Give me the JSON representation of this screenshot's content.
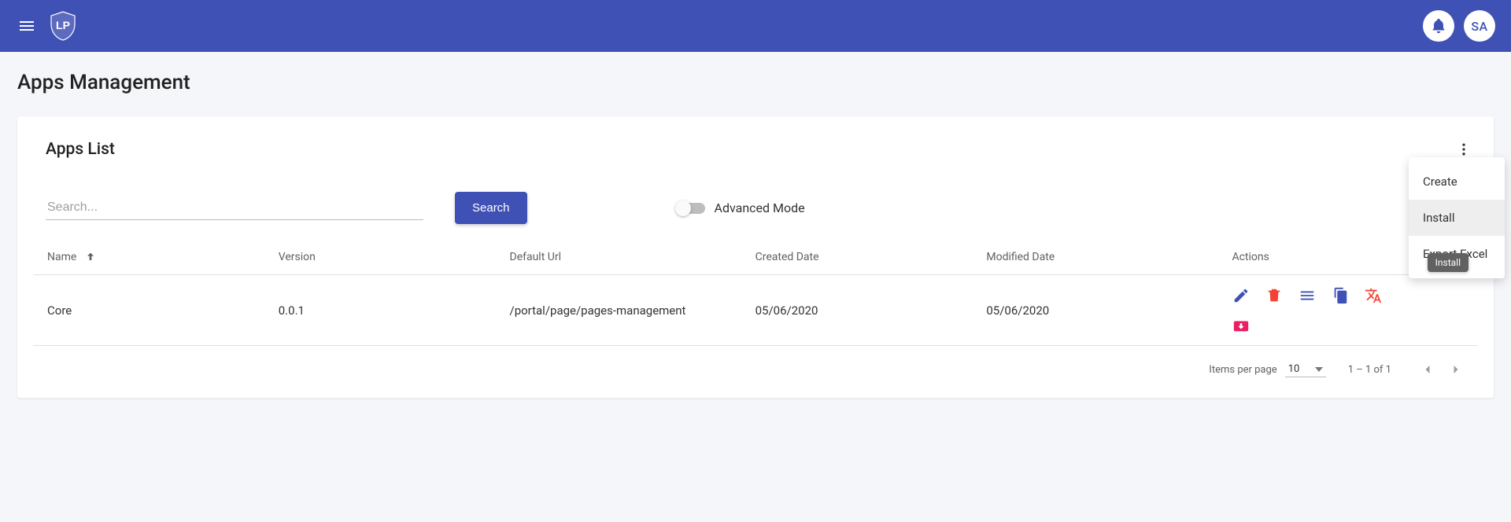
{
  "appbar": {
    "user_initials": "SA"
  },
  "page": {
    "title": "Apps Management"
  },
  "card": {
    "title": "Apps List"
  },
  "filter": {
    "search_placeholder": "Search...",
    "search_button": "Search",
    "advanced_mode_label": "Advanced Mode",
    "advanced_mode_on": false
  },
  "table": {
    "columns": {
      "name": "Name",
      "version": "Version",
      "default_url": "Default Url",
      "created_date": "Created Date",
      "modified_date": "Modified Date",
      "actions": "Actions"
    },
    "sort_column": "name",
    "sort_direction": "asc",
    "rows": [
      {
        "name": "Core",
        "version": "0.0.1",
        "default_url": "/portal/page/pages-management",
        "created_date": "05/06/2020",
        "modified_date": "05/06/2020"
      }
    ]
  },
  "paginator": {
    "items_per_page_label": "Items per page",
    "page_size": "10",
    "range_label": "1 – 1 of 1"
  },
  "menu": {
    "items": [
      {
        "label": "Create",
        "highlighted": false
      },
      {
        "label": "Install",
        "highlighted": true
      },
      {
        "label": "Export Excel",
        "highlighted": false
      }
    ]
  },
  "tooltip": {
    "text": "Install"
  },
  "colors": {
    "primary": "#3F51B5",
    "danger": "#F44336",
    "accent_pink": "#E91E63",
    "accent_orange": "#F44336"
  }
}
